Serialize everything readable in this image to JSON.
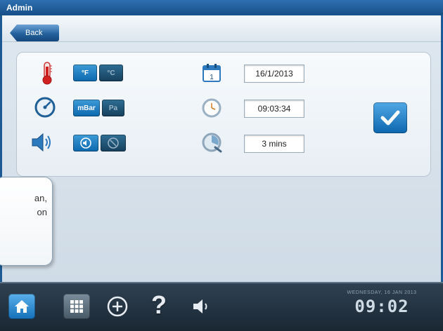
{
  "window": {
    "title": "Admin"
  },
  "nav": {
    "back_label": "Back"
  },
  "settings": {
    "temperature": {
      "icon": "thermometer-icon",
      "options": [
        "°F",
        "°C"
      ],
      "selected": "°F"
    },
    "pressure": {
      "icon": "gauge-icon",
      "options": [
        "mBar",
        "Pa"
      ],
      "selected": "mBar"
    },
    "sound": {
      "icon": "speaker-icon",
      "options": [
        "sound-on-icon",
        "sound-off-icon"
      ],
      "selected": "sound-on-icon"
    },
    "date": {
      "icon": "calendar-icon",
      "value": "16/1/2013"
    },
    "time": {
      "icon": "clock-icon",
      "value": "09:03:34"
    },
    "timeout": {
      "icon": "screensaver-timer-icon",
      "value": "3 mins"
    },
    "confirm": {
      "icon": "checkmark-icon"
    }
  },
  "tooltip": {
    "lines": [
      "an,",
      "on"
    ]
  },
  "taskbar": {
    "buttons": [
      "home-icon",
      "grid-icon",
      "plus-circle-icon",
      "help-icon",
      "volume-icon"
    ],
    "help_label": "?",
    "date": "WEDNESDAY, 16 JAN 2013",
    "time": "09:02"
  },
  "colors": {
    "accent": "#1470b8",
    "titlebar": "#184f88",
    "taskbar": "#1a2733"
  }
}
